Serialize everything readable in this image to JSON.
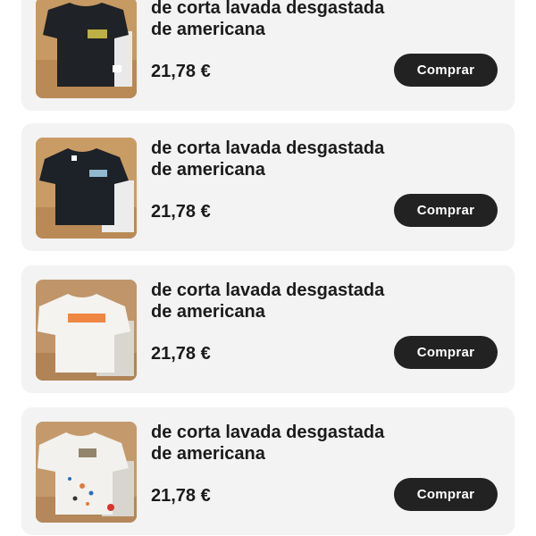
{
  "products": [
    {
      "title_line1": "de corta lavada desgastada",
      "title_line2": "de americana",
      "price": "21,78 €",
      "button_label": "Comprar",
      "image": {
        "icon": "black-tshirt-image",
        "shirt_color": "#1f2226",
        "print_color": "#d8c84a"
      }
    },
    {
      "title_line1": "de corta lavada desgastada",
      "title_line2": "de americana",
      "price": "21,78 €",
      "button_label": "Comprar",
      "image": {
        "icon": "black-tshirt-image",
        "shirt_color": "#1d2128",
        "print_color": "#9fc9e0"
      }
    },
    {
      "title_line1": "de corta lavada desgastada",
      "title_line2": "de americana",
      "price": "21,78 €",
      "button_label": "Comprar",
      "image": {
        "icon": "white-tshirt-image",
        "shirt_color": "#f4f3f0",
        "print_color": "#ee7a2e"
      }
    },
    {
      "title_line1": "de corta lavada desgastada",
      "title_line2": "de americana",
      "price": "21,78 €",
      "button_label": "Comprar",
      "image": {
        "icon": "white-tshirt-image",
        "shirt_color": "#f2f1ee",
        "print_color": "#7a6a4a"
      }
    }
  ]
}
